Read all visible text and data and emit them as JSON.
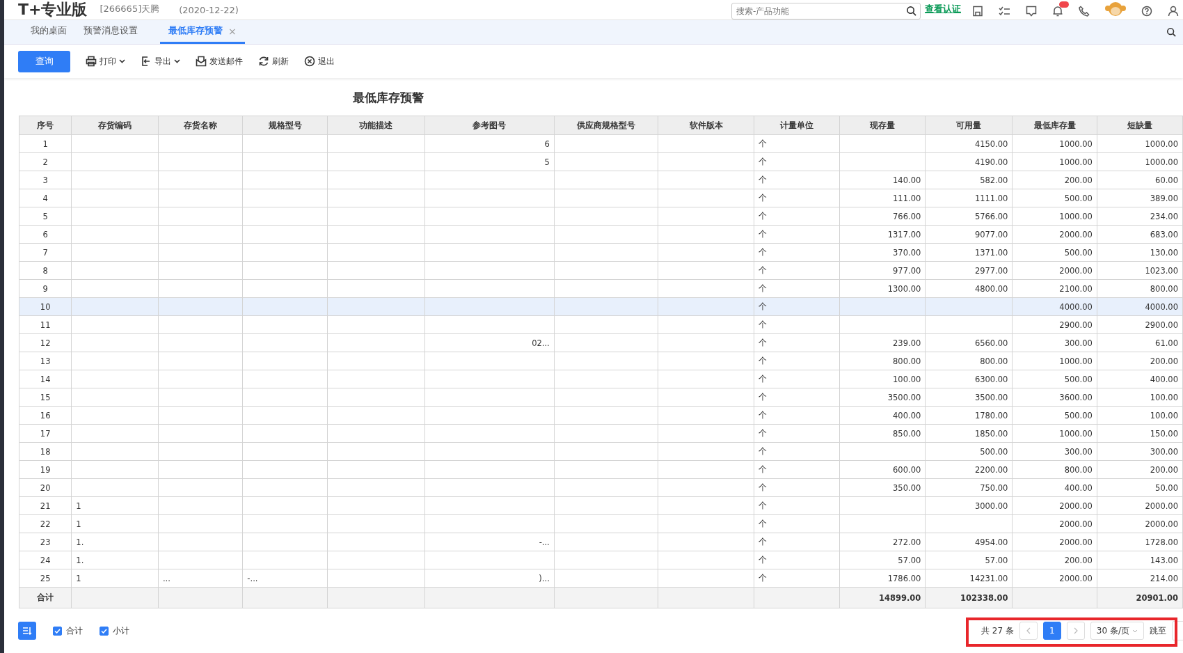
{
  "header": {
    "logo": "T+专业版",
    "account": "[266665]天腾",
    "date": "(2020-12-22)",
    "search": {
      "placeholder": "搜索-产品功能"
    },
    "verify_link": "查看认证",
    "notification_badge": true
  },
  "tabs": [
    {
      "label": "我的桌面",
      "selected": false
    },
    {
      "label": "预警消息设置",
      "selected": false
    },
    {
      "label": "最低库存预警",
      "selected": true,
      "close_icon": "×"
    }
  ],
  "toolbar": [
    {
      "kind": "primary",
      "label": "查询"
    },
    {
      "kind": "print",
      "label": "打印",
      "dropdown": true
    },
    {
      "kind": "export",
      "label": "导出",
      "dropdown": true
    },
    {
      "kind": "mail",
      "label": "发送邮件",
      "dropdown": false
    },
    {
      "kind": "refresh",
      "label": "刷新",
      "dropdown": false
    },
    {
      "kind": "exit",
      "label": "退出",
      "dropdown": false
    }
  ],
  "report_title": "最低库存预警",
  "table": {
    "columns": [
      "序号",
      "存货编码",
      "存货名称",
      "规格型号",
      "功能描述",
      "参考图号",
      "供应商规格型号",
      "软件版本",
      "计量单位",
      "现存量",
      "可用量",
      "最低库存量",
      "短缺量"
    ],
    "rows": [
      {
        "selected": false,
        "no": "1",
        "ref": "6",
        "unit": "个",
        "available": "4150.00",
        "min_stock": "1000.00",
        "shortage": "1000.00"
      },
      {
        "selected": false,
        "no": "2",
        "ref": "5",
        "unit": "个",
        "available": "4190.00",
        "min_stock": "1000.00",
        "shortage": "1000.00"
      },
      {
        "selected": false,
        "no": "3",
        "unit": "个",
        "on_hand": "140.00",
        "available": "582.00",
        "min_stock": "200.00",
        "shortage": "60.00"
      },
      {
        "selected": false,
        "no": "4",
        "unit": "个",
        "on_hand": "111.00",
        "available": "1111.00",
        "min_stock": "500.00",
        "shortage": "389.00"
      },
      {
        "selected": false,
        "no": "5",
        "unit": "个",
        "on_hand": "766.00",
        "available": "5766.00",
        "min_stock": "1000.00",
        "shortage": "234.00"
      },
      {
        "selected": false,
        "no": "6",
        "unit": "个",
        "on_hand": "1317.00",
        "available": "9077.00",
        "min_stock": "2000.00",
        "shortage": "683.00"
      },
      {
        "selected": false,
        "no": "7",
        "unit": "个",
        "on_hand": "370.00",
        "available": "1371.00",
        "min_stock": "500.00",
        "shortage": "130.00"
      },
      {
        "selected": false,
        "no": "8",
        "unit": "个",
        "on_hand": "977.00",
        "available": "2977.00",
        "min_stock": "2000.00",
        "shortage": "1023.00"
      },
      {
        "selected": false,
        "no": "9",
        "unit": "个",
        "on_hand": "1300.00",
        "available": "4800.00",
        "min_stock": "2100.00",
        "shortage": "800.00"
      },
      {
        "selected": true,
        "no": "10",
        "unit": "个",
        "min_stock": "4000.00",
        "shortage": "4000.00"
      },
      {
        "selected": false,
        "no": "11",
        "unit": "个",
        "min_stock": "2900.00",
        "shortage": "2900.00"
      },
      {
        "selected": false,
        "no": "12",
        "ref": "02...",
        "unit": "个",
        "on_hand": "239.00",
        "available": "6560.00",
        "min_stock": "300.00",
        "shortage": "61.00"
      },
      {
        "selected": false,
        "no": "13",
        "unit": "个",
        "on_hand": "800.00",
        "available": "800.00",
        "min_stock": "1000.00",
        "shortage": "200.00"
      },
      {
        "selected": false,
        "no": "14",
        "unit": "个",
        "on_hand": "100.00",
        "available": "6300.00",
        "min_stock": "500.00",
        "shortage": "400.00"
      },
      {
        "selected": false,
        "no": "15",
        "unit": "个",
        "on_hand": "3500.00",
        "available": "3500.00",
        "min_stock": "3600.00",
        "shortage": "100.00"
      },
      {
        "selected": false,
        "no": "16",
        "unit": "个",
        "on_hand": "400.00",
        "available": "1780.00",
        "min_stock": "500.00",
        "shortage": "100.00"
      },
      {
        "selected": false,
        "no": "17",
        "unit": "个",
        "on_hand": "850.00",
        "available": "1850.00",
        "min_stock": "1000.00",
        "shortage": "150.00"
      },
      {
        "selected": false,
        "no": "18",
        "unit": "个",
        "available": "500.00",
        "min_stock": "300.00",
        "shortage": "300.00"
      },
      {
        "selected": false,
        "no": "19",
        "unit": "个",
        "on_hand": "600.00",
        "available": "2200.00",
        "min_stock": "800.00",
        "shortage": "200.00"
      },
      {
        "selected": false,
        "no": "20",
        "unit": "个",
        "on_hand": "350.00",
        "available": "750.00",
        "min_stock": "400.00",
        "shortage": "50.00"
      },
      {
        "selected": false,
        "no": "21",
        "code": "1",
        "unit": "个",
        "available": "3000.00",
        "min_stock": "2000.00",
        "shortage": "2000.00"
      },
      {
        "selected": false,
        "no": "22",
        "code": "1",
        "unit": "个",
        "min_stock": "2000.00",
        "shortage": "2000.00"
      },
      {
        "selected": false,
        "no": "23",
        "code": "1.",
        "ref": "-...",
        "unit": "个",
        "on_hand": "272.00",
        "available": "4954.00",
        "min_stock": "2000.00",
        "shortage": "1728.00"
      },
      {
        "selected": false,
        "no": "24",
        "code": "1.",
        "unit": "个",
        "on_hand": "57.00",
        "available": "57.00",
        "min_stock": "200.00",
        "shortage": "143.00"
      },
      {
        "selected": false,
        "no": "25",
        "code": "1",
        "name": "...",
        "spec": "-...",
        "ref": ")...",
        "unit": "个",
        "on_hand": "1786.00",
        "available": "14231.00",
        "min_stock": "2000.00",
        "shortage": "214.00"
      }
    ],
    "totals": {
      "no": "合计",
      "on_hand": "14899.00",
      "available": "102338.00",
      "shortage": "20901.00"
    }
  },
  "footer": {
    "options": [
      {
        "label": "合计",
        "checked": true
      },
      {
        "label": "小计",
        "checked": true
      }
    ],
    "pagination": {
      "total": "共 27 条",
      "pages": [
        {
          "label": "1",
          "selected": true
        }
      ],
      "page_size": "30 条/页",
      "jump_label": "跳至"
    }
  },
  "annotation": {
    "kind": "highlight-box",
    "color": "#e8262b"
  }
}
